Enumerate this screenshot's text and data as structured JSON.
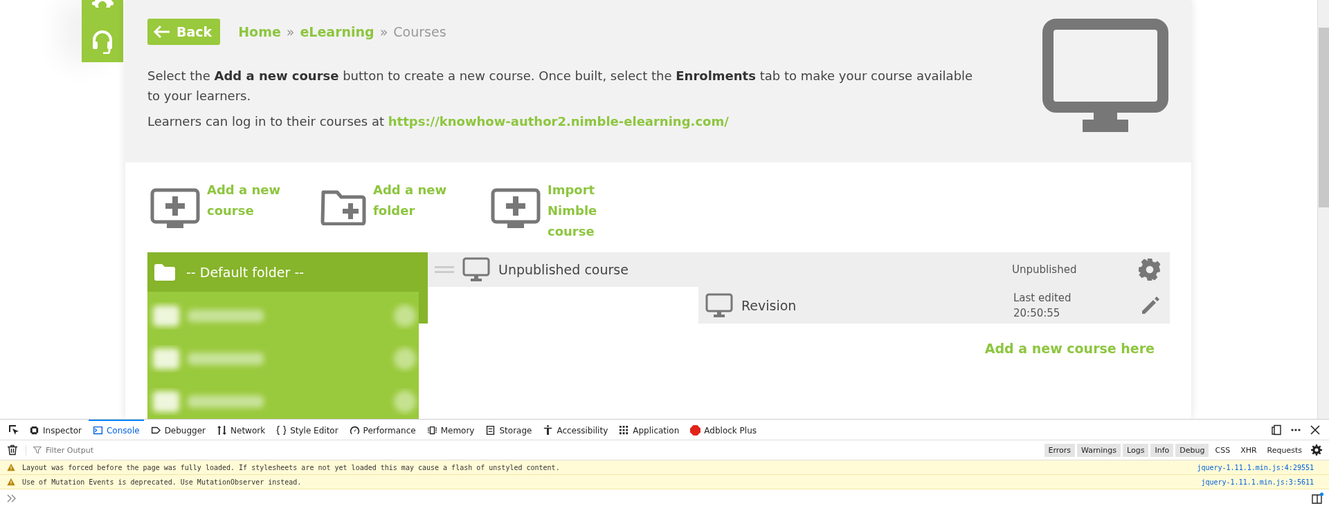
{
  "header": {
    "back_button": "Back",
    "breadcrumb": [
      {
        "label": "Home",
        "kind": "link"
      },
      {
        "label": "»",
        "kind": "separator"
      },
      {
        "label": "eLearning",
        "kind": "link"
      },
      {
        "label": "»",
        "kind": "separator"
      },
      {
        "label": "Courses",
        "kind": "current"
      }
    ],
    "intro": "Select the **Add a new course** button to create a new course. Once built, select the **Enrolments** tab to make your course available to your learners.",
    "login_note": {
      "text": "Learners can log in to their courses at",
      "url": "https://knowhow-author2.nimble-elearning.com/"
    }
  },
  "actions": [
    {
      "label": "Add a new course",
      "kind": "course"
    },
    {
      "label": "Add a new folder",
      "kind": "folder"
    },
    {
      "label": "Import Nimble course",
      "kind": "course"
    }
  ],
  "folders": [
    {
      "label": "-- Default folder --",
      "selected": true
    }
  ],
  "courses": [
    {
      "title": "Unpublished course",
      "status": "Unpublished",
      "revisions": [
        {
          "title": "Revision",
          "edited_label": "Last edited",
          "edited_time": "20:50:55"
        }
      ]
    }
  ],
  "add_course_here": "Add a new course here",
  "devtools": {
    "tabs": [
      {
        "label": "Inspector",
        "selected": false
      },
      {
        "label": "Console",
        "selected": true
      },
      {
        "label": "Debugger",
        "selected": false
      },
      {
        "label": "Network",
        "selected": false
      },
      {
        "label": "Style Editor",
        "selected": false
      },
      {
        "label": "Performance",
        "selected": false
      },
      {
        "label": "Memory",
        "selected": false
      },
      {
        "label": "Storage",
        "selected": false
      },
      {
        "label": "Accessibility",
        "selected": false
      },
      {
        "label": "Application",
        "selected": false
      },
      {
        "label": "Adblock Plus",
        "selected": false
      }
    ],
    "filter_placeholder": "Filter Output",
    "filters": [
      {
        "label": "Errors",
        "selected": true
      },
      {
        "label": "Warnings",
        "selected": true
      },
      {
        "label": "Logs",
        "selected": true
      },
      {
        "label": "Info",
        "selected": true
      },
      {
        "label": "Debug",
        "selected": true
      },
      {
        "label": "CSS",
        "selected": false
      },
      {
        "label": "XHR",
        "selected": false
      },
      {
        "label": "Requests",
        "selected": false
      }
    ],
    "messages": [
      {
        "text": "Layout was forced before the page was fully loaded. If stylesheets are not yet loaded this may cause a flash of unstyled content.",
        "source": "jquery-1.11.1.min.js:4:29551"
      },
      {
        "text": "Use of Mutation Events is deprecated. Use MutationObserver instead.",
        "source": "jquery-1.11.1.min.js:3:5611"
      }
    ]
  }
}
